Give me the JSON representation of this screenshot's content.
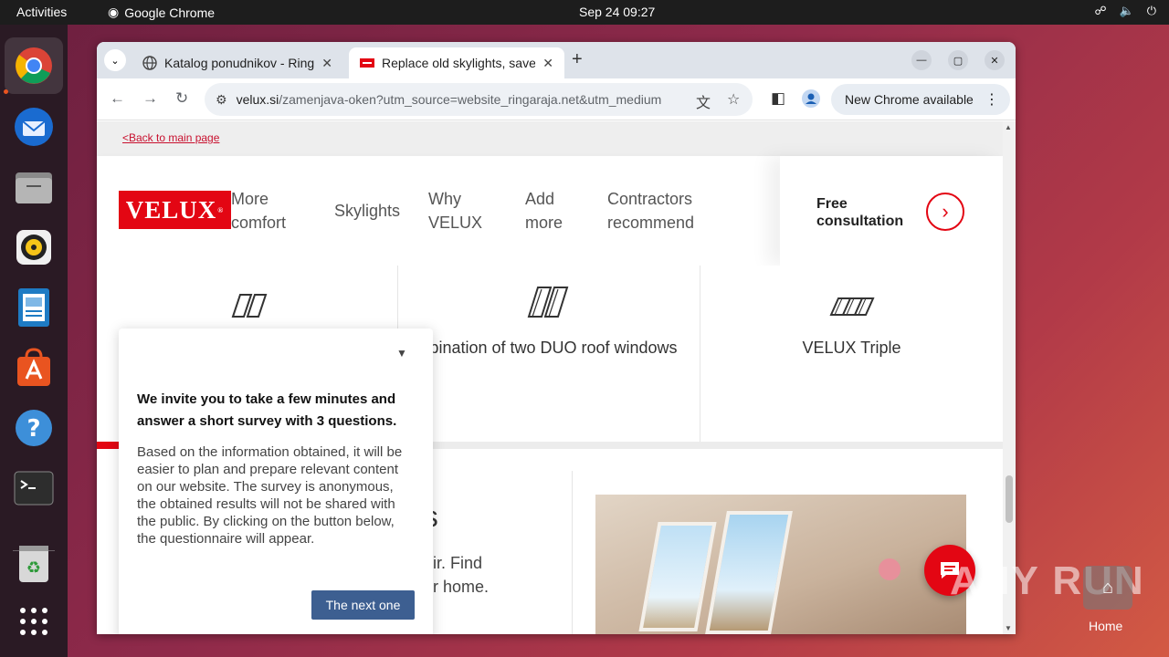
{
  "topbar": {
    "activities": "Activities",
    "app_name": "Google Chrome",
    "clock": "Sep 24  09:27"
  },
  "browser": {
    "tabs": [
      {
        "title": "Katalog ponudnikov - Ringaraja.net",
        "active": false
      },
      {
        "title": "Replace old skylights, save energy",
        "active": true
      }
    ],
    "url_host": "velux.si",
    "url_path": "/zamenjava-oken?utm_source=website_ringaraja.net&utm_medium...",
    "new_chrome_label": "New Chrome available"
  },
  "page": {
    "back_link": "<Back to main page",
    "logo_text": "VELUX",
    "logo_reg": "®",
    "nav": {
      "more_comfort": [
        "More",
        "comfort"
      ],
      "skylights": "Skylights",
      "why_velux": [
        "Why",
        "VELUX"
      ],
      "add_more": [
        "Add",
        "more"
      ],
      "contractors": [
        "Contractors",
        "recommend"
      ]
    },
    "free_consultation": [
      "Free",
      "consultation"
    ],
    "products": [
      {
        "label": ""
      },
      {
        "label": "nbination of two DUO roof windows"
      },
      {
        "label": "VELUX Triple"
      }
    ],
    "section_heading_fragment": "ns",
    "section_sub_fragment_1": "air. Find",
    "section_sub_fragment_2": "ur home."
  },
  "survey": {
    "question": "We invite you to take a few minutes and answer a short survey with 3 questions.",
    "body": "Based on the information obtained, it will be easier to plan and prepare relevant content on our website. The survey is anonymous, the obtained results will not be shared with the public. By clicking on the button below, the questionnaire will appear.",
    "next_label": "The next one"
  },
  "desktop": {
    "watermark": "ANY RUN",
    "home_label": "Home"
  },
  "colors": {
    "velux_red": "#e30613",
    "survey_button": "#3d5f91"
  }
}
